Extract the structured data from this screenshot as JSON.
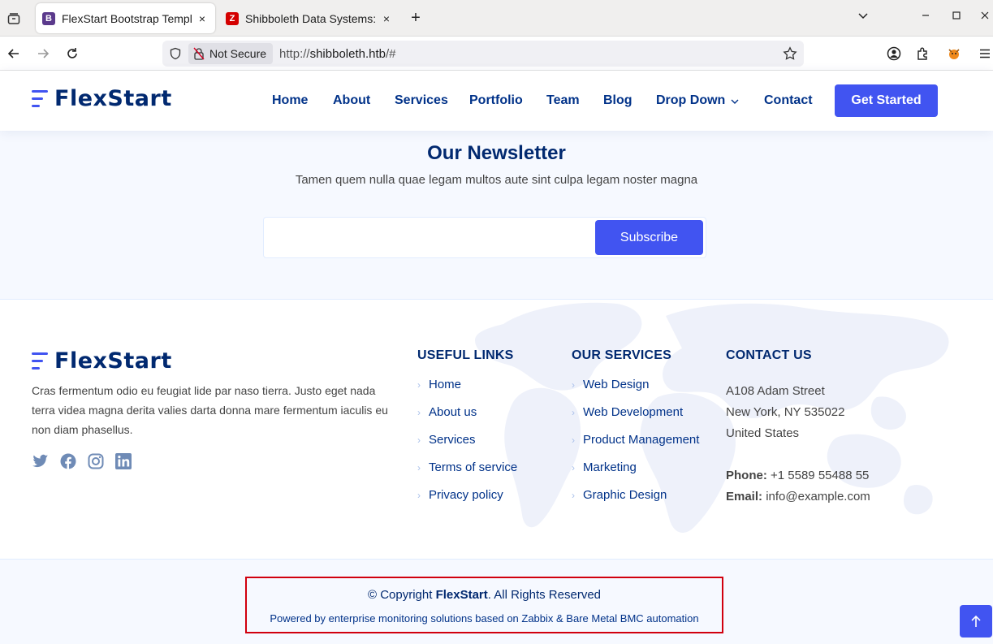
{
  "browser": {
    "tabs": [
      {
        "title": "FlexStart Bootstrap Template",
        "favicon": "B",
        "close": "×"
      },
      {
        "title": "Shibboleth Data Systems: Zabbix",
        "favicon": "Z",
        "close": "×"
      }
    ],
    "new_tab": "+",
    "security_label": "Not Secure",
    "url_scheme": "http://",
    "url_host": "shibboleth.htb",
    "url_path": "/#"
  },
  "site": {
    "logo": "FlexStart",
    "nav": [
      "Home",
      "About",
      "Services",
      "Portfolio",
      "Team",
      "Blog",
      "Drop Down",
      "Contact"
    ],
    "cta": "Get Started",
    "accent": "#4154f1",
    "navy": "#012970"
  },
  "newsletter": {
    "title": "Our Newsletter",
    "subtitle": "Tamen quem nulla quae legam multos aute sint culpa legam noster magna",
    "input_value": "",
    "button": "Subscribe"
  },
  "footer": {
    "logo": "FlexStart",
    "about": "Cras fermentum odio eu feugiat lide par naso tierra. Justo eget nada terra videa magna derita valies darta donna mare fermentum iaculis eu non diam phasellus.",
    "socials": [
      "twitter-icon",
      "facebook-icon",
      "instagram-icon",
      "linkedin-icon"
    ],
    "useful_links": {
      "title": "USEFUL LINKS",
      "items": [
        "Home",
        "About us",
        "Services",
        "Terms of service",
        "Privacy policy"
      ]
    },
    "our_services": {
      "title": "OUR SERVICES",
      "items": [
        "Web Design",
        "Web Development",
        "Product Management",
        "Marketing",
        "Graphic Design"
      ]
    },
    "contact": {
      "title": "CONTACT US",
      "address1": "A108 Adam Street",
      "address2": "New York, NY 535022",
      "address3": "United States",
      "phone_label": "Phone:",
      "phone": "+1 5589 55488 55",
      "email_label": "Email:",
      "email": "info@example.com"
    },
    "copyright_prefix": "© Copyright ",
    "copyright_brand": "FlexStart",
    "copyright_suffix": ". All Rights Reserved",
    "credits": "Powered by enterprise monitoring solutions based on Zabbix & Bare Metal BMC automation"
  }
}
